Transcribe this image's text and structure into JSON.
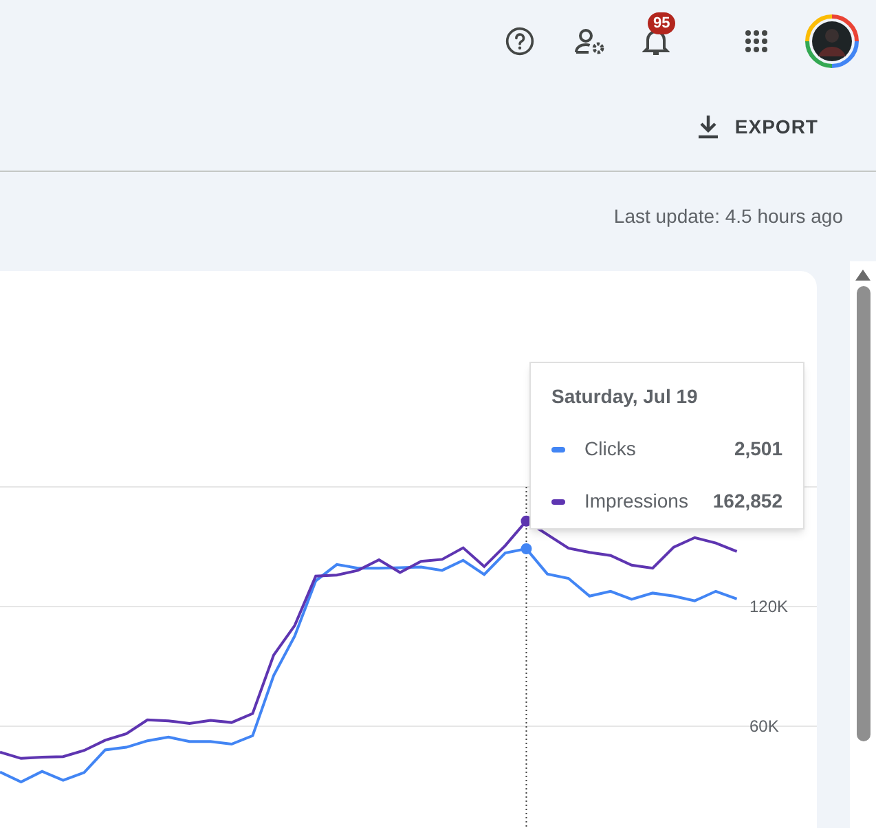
{
  "header": {
    "notifications_badge": "95"
  },
  "toolbar": {
    "export_label": "EXPORT"
  },
  "last_update": "Last update: 4.5 hours ago",
  "chart": {
    "chart_data": {
      "type": "line",
      "categories": [
        null,
        null,
        null,
        null,
        null,
        null,
        null,
        null,
        null,
        null,
        null,
        null,
        null,
        null,
        null,
        null,
        null,
        null,
        null,
        null,
        null,
        null,
        null,
        null,
        null,
        null,
        null,
        null,
        null,
        null,
        null,
        null,
        null,
        null,
        null,
        null
      ],
      "ylim": [
        9000,
        288300
      ],
      "yticks": [
        {
          "value": 60000,
          "label": "60K"
        },
        {
          "value": 120000,
          "label": "120K"
        }
      ],
      "legend": true,
      "series": [
        {
          "name": "Clicks",
          "color": "#4285f4",
          "values": [
            37100,
            32100,
            37400,
            32900,
            36800,
            48200,
            49500,
            52700,
            54600,
            52400,
            52400,
            51100,
            55300,
            85400,
            105200,
            132900,
            141100,
            139300,
            139300,
            139500,
            139800,
            138200,
            143200,
            136100,
            146900,
            149000,
            136400,
            134200,
            125300,
            127700,
            123700,
            126800,
            125300,
            122900,
            127700,
            123900
          ]
        },
        {
          "name": "Impressions",
          "color": "#5e35b1",
          "values": [
            47100,
            43900,
            44500,
            44800,
            47900,
            53000,
            56300,
            63200,
            62700,
            61400,
            63000,
            61900,
            66400,
            95700,
            110500,
            135300,
            135800,
            138200,
            143500,
            137100,
            142700,
            143700,
            149500,
            140100,
            150600,
            162900,
            null,
            149300,
            147200,
            145600,
            140800,
            139300,
            149800,
            154600,
            151900,
            147700
          ]
        }
      ]
    },
    "tooltip": {
      "title": "Saturday, Jul 19",
      "values": [
        "2,501",
        "162,852"
      ]
    }
  }
}
